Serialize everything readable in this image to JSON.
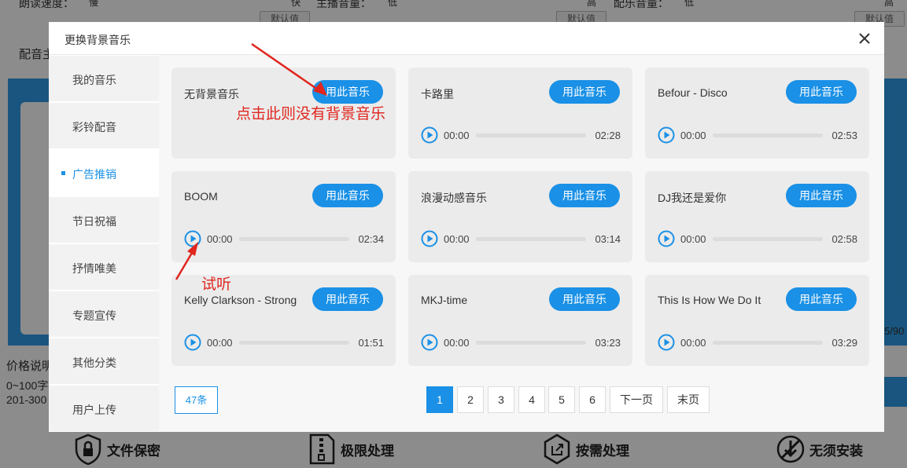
{
  "background": {
    "top_labels": [
      "朗读速度：",
      "慢",
      "快",
      "主播音量：",
      "低",
      "高",
      "配乐音量：",
      "低",
      "高"
    ],
    "default_button": "默认值",
    "peiyin_label": "配音主",
    "right_number": "5/90",
    "price_title": "价格说明",
    "price_line1": "0~100字",
    "price_line2": "201-300",
    "features": [
      {
        "label": "文件保密",
        "icon": "shield-lock-icon"
      },
      {
        "label": "极限处理",
        "icon": "zip-file-icon"
      },
      {
        "label": "按需处理",
        "icon": "hexagon-export-icon"
      },
      {
        "label": "无须安装",
        "icon": "no-install-icon"
      }
    ]
  },
  "modal": {
    "title": "更换背景音乐",
    "close_icon": "close-icon",
    "accent_color": "#1a90e6",
    "sidebar": [
      {
        "label": "我的音乐",
        "active": false
      },
      {
        "label": "彩铃配音",
        "active": false
      },
      {
        "label": "广告推销",
        "active": true
      },
      {
        "label": "节日祝福",
        "active": false
      },
      {
        "label": "抒情唯美",
        "active": false
      },
      {
        "label": "专题宣传",
        "active": false
      },
      {
        "label": "其他分类",
        "active": false
      },
      {
        "label": "用户上传",
        "active": false
      }
    ],
    "use_button_label": "用此音乐",
    "tracks": [
      {
        "title": "无背景音乐",
        "current": "",
        "duration": "",
        "has_player": false
      },
      {
        "title": "卡路里",
        "current": "00:00",
        "duration": "02:28",
        "has_player": true
      },
      {
        "title": "Befour - Disco",
        "current": "00:00",
        "duration": "02:53",
        "has_player": true
      },
      {
        "title": "BOOM",
        "current": "00:00",
        "duration": "02:34",
        "has_player": true
      },
      {
        "title": "浪漫动感音乐",
        "current": "00:00",
        "duration": "03:14",
        "has_player": true
      },
      {
        "title": "DJ我还是爱你",
        "current": "00:00",
        "duration": "02:58",
        "has_player": true
      },
      {
        "title": "Kelly Clarkson - Strong",
        "current": "00:00",
        "duration": "01:51",
        "has_player": true
      },
      {
        "title": "MKJ-time",
        "current": "00:00",
        "duration": "03:23",
        "has_player": true
      },
      {
        "title": "This Is How We Do It",
        "current": "00:00",
        "duration": "03:29",
        "has_player": true
      }
    ],
    "total_count": "47条",
    "pagination": {
      "pages": [
        "1",
        "2",
        "3",
        "4",
        "5",
        "6"
      ],
      "current": "1",
      "next": "下一页",
      "last": "末页"
    }
  },
  "annotations": {
    "no_music_note": "点击此则没有背景音乐",
    "preview_note": "试听",
    "color": "#e0261e"
  }
}
